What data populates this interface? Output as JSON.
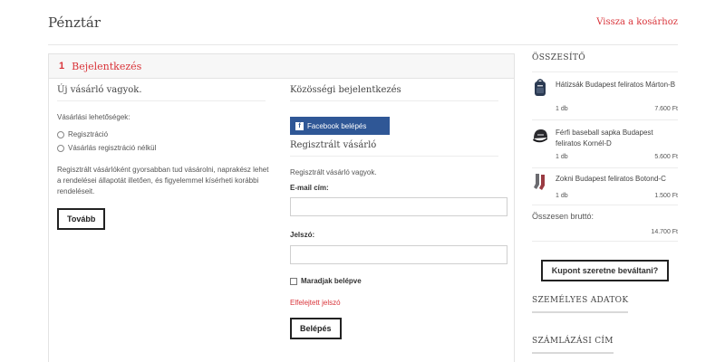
{
  "header": {
    "title": "Pénztár",
    "back_link": "Vissza a kosárhoz"
  },
  "checkout": {
    "step": {
      "number": "1",
      "title": "Bejelentkezés"
    },
    "new_customer": {
      "heading": "Új vásárló vagyok.",
      "options_label": "Vásárlási lehetőségek:",
      "options": [
        "Regisztráció",
        "Vásárlás regisztráció nélkül"
      ],
      "description": "Regisztrált vásárlóként gyorsabban tud vásárolni, naprakész lehet a rendelései állapotát illetően, és figyelemmel kísérheti korábbi rendeléseit.",
      "continue_button": "Tovább"
    },
    "social_login": {
      "heading": "Közösségi bejelentkezés",
      "facebook_button": "Facebook belépés"
    },
    "registered": {
      "heading": "Regisztrált vásárló",
      "note": "Regisztrált vásárló vagyok.",
      "email_label": "E-mail cím:",
      "email_value": "",
      "password_label": "Jelszó:",
      "password_value": "",
      "remember_label": "Maradjak belépve",
      "forgot_link": "Elfelejtett jelszó",
      "login_button": "Belépés"
    }
  },
  "summary": {
    "heading": "ÖSSZESÍTŐ",
    "items": [
      {
        "name": "Hátizsák Budapest feliratos Márton-B",
        "qty": "1 db",
        "price": "7.600 Ft",
        "icon": "backpack-icon"
      },
      {
        "name": "Férfi baseball sapka Budapest feliratos Kornél-D",
        "qty": "1 db",
        "price": "5.600 Ft",
        "icon": "cap-icon"
      },
      {
        "name": "Zokni Budapest feliratos Botond-C",
        "qty": "1 db",
        "price": "1.500 Ft",
        "icon": "socks-icon"
      }
    ],
    "total_label": "Összesen bruttó:",
    "total_value": "14.700 Ft",
    "coupon_button": "Kupont szeretne beváltani?",
    "sections": [
      "SZEMÉLYES ADATOK",
      "SZÁMLÁZÁSI CÍM"
    ]
  },
  "colors": {
    "accent": "#d9343a",
    "facebook": "#2f5796"
  }
}
